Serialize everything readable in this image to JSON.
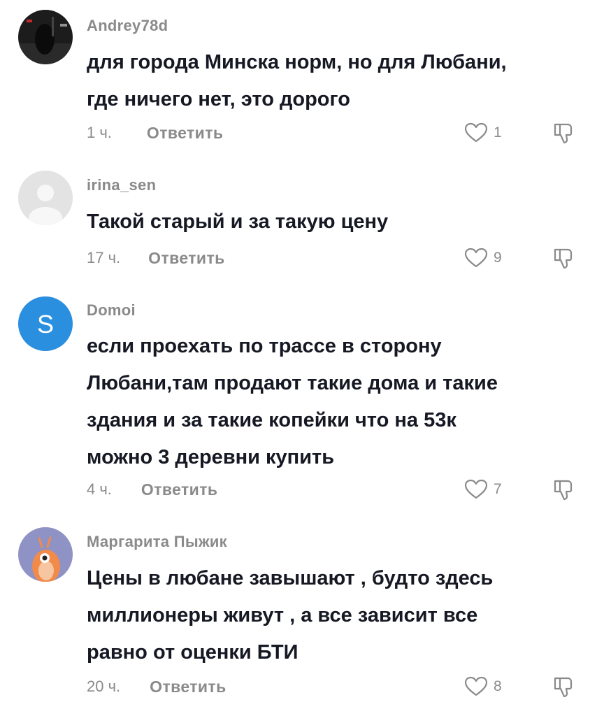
{
  "comments": [
    {
      "username": "Andrey78d",
      "lines": [
        "для города Минска норм, но для Любани,",
        "где ничего нет, это дорого"
      ],
      "time": "1 ч.",
      "reply_label": "Ответить",
      "likes": "1",
      "avatar": "photo"
    },
    {
      "username": "irina_sen",
      "lines": [
        "Такой старый и за такую цену"
      ],
      "time": "17 ч.",
      "reply_label": "Ответить",
      "likes": "9",
      "avatar": "default-silhouette"
    },
    {
      "username": "Domoi",
      "lines": [
        "если проехать по трассе в сторону",
        "Любани,там продают такие дома и такие",
        "здания и за такие копейки что на 53к",
        "можно 3 деревни купить"
      ],
      "time": "4 ч.",
      "reply_label": "Ответить",
      "likes": "7",
      "avatar": "letter",
      "avatar_letter": "S",
      "avatar_color": "#2b8fe0"
    },
    {
      "username": "Маргарита Пыжик",
      "lines": [
        "Цены в любане завышают , будто здесь",
        "миллионеры живут , а все зависит все",
        "равно от оценки БТИ"
      ],
      "time": "20 ч.",
      "reply_label": "Ответить",
      "likes": "8",
      "avatar": "illustration"
    }
  ],
  "icons": {
    "like": "heart-outline-icon",
    "dislike": "thumbs-down-icon"
  },
  "colors": {
    "text": "#161823",
    "muted": "#8a8a8a"
  }
}
